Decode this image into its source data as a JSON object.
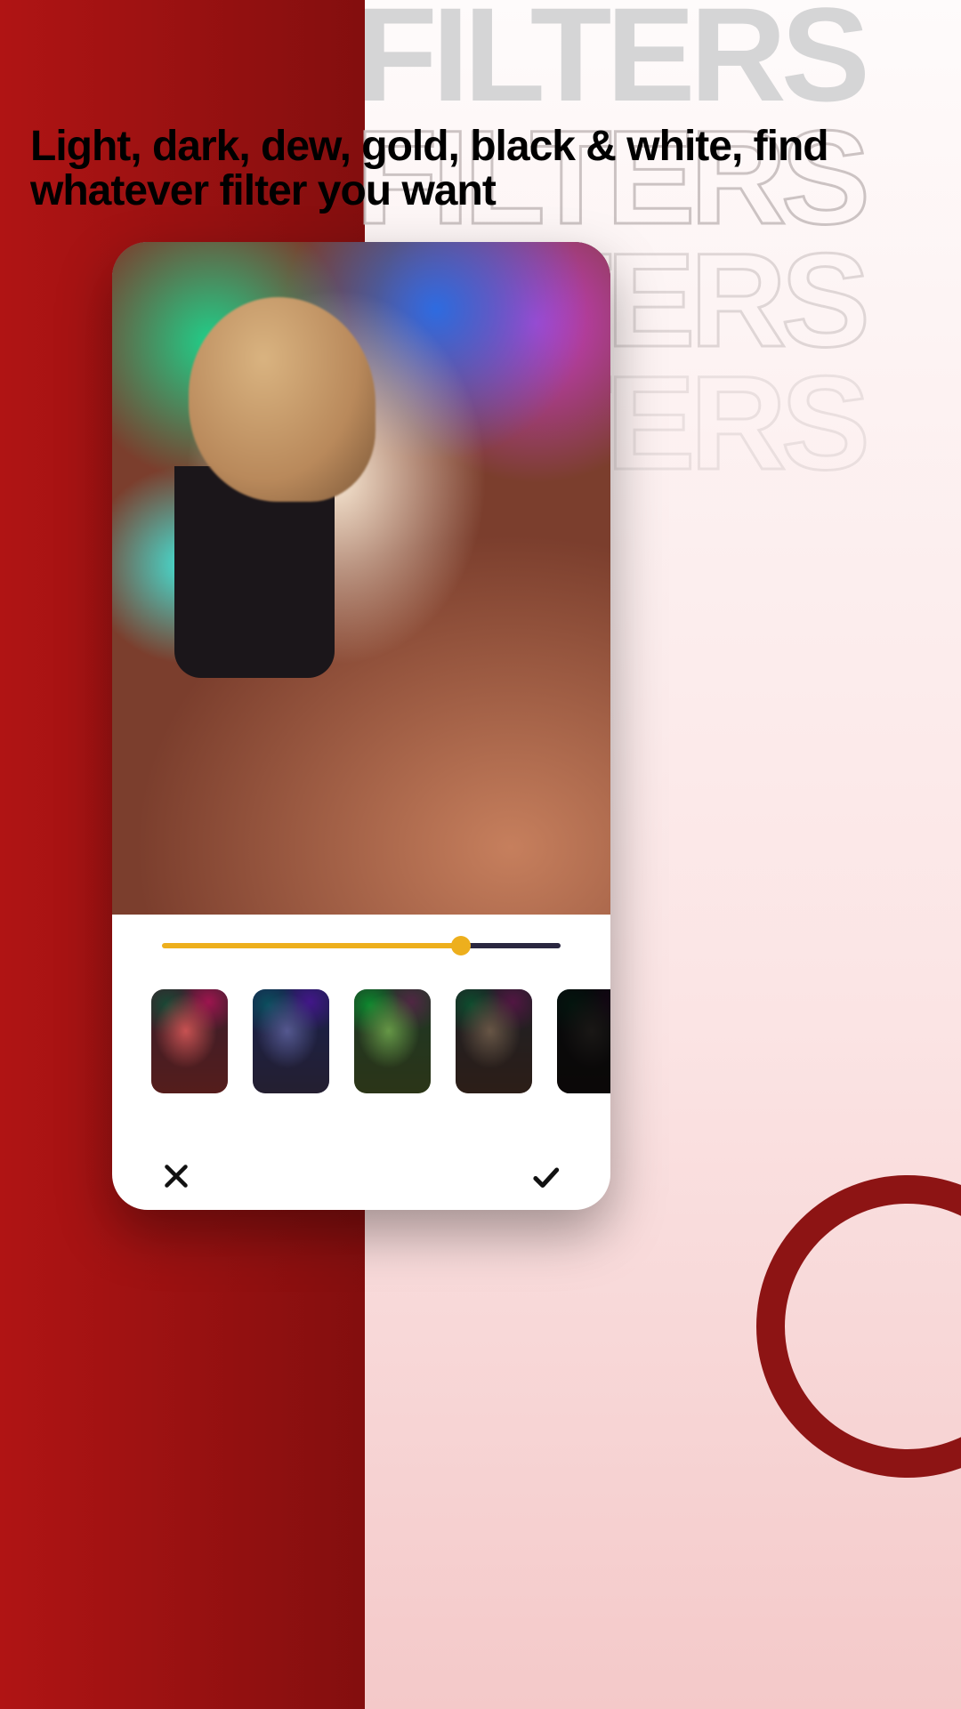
{
  "hero": {
    "title_word": "FILTERS",
    "headline": "Light, dark, dew, gold, black & white, find whatever filter you want"
  },
  "editor": {
    "slider": {
      "percent": 75,
      "fill_color": "#EDAF1D"
    },
    "filter_thumbnails": [
      {
        "name": "red",
        "tint_css": "rgba(178, 25, 38, 0.72)"
      },
      {
        "name": "blue",
        "tint_css": "rgba(18, 35, 140, 0.72)"
      },
      {
        "name": "green",
        "tint_css": "rgba(42, 130, 18, 0.72)"
      },
      {
        "name": "sepia",
        "tint_css": "rgba(60, 48, 34, 0.78)"
      },
      {
        "name": "bw",
        "tint_css": "rgba(0, 0, 0, 0.9)"
      }
    ],
    "actions": {
      "cancel_icon": "close-icon",
      "confirm_icon": "check-icon"
    }
  }
}
